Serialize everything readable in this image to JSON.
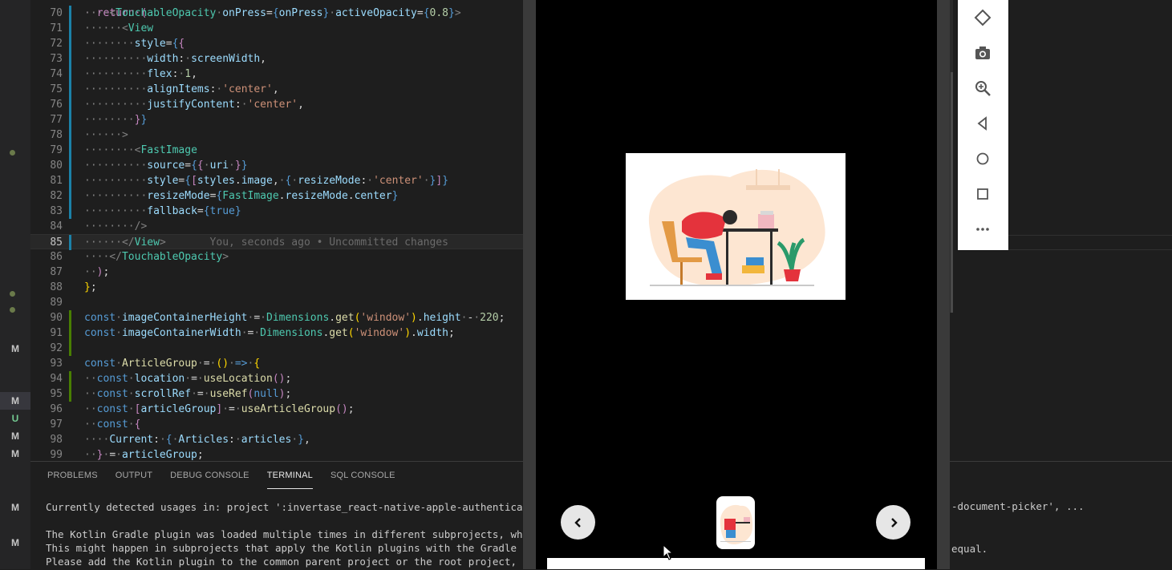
{
  "editor": {
    "lines": [
      {
        "no": "70",
        "bar": "mod",
        "html": "<span class='p'>····</span><span class='p'>&lt;</span><span class='t'>TouchableOpacity</span><span class='p'>·</span><span class='a'>onPress</span><span class='d'>=</span><span class='k'>{</span><span class='a'>onPress</span><span class='k'>}</span><span class='p'>·</span><span class='a'>activeOpacity</span><span class='d'>=</span><span class='k'>{</span><span class='n'>0.8</span><span class='k'>}</span><span class='p'>&gt;</span>"
      },
      {
        "no": "71",
        "bar": "mod",
        "html": "<span class='p'>······&lt;</span><span class='t'>View</span>"
      },
      {
        "no": "72",
        "bar": "mod",
        "html": "<span class='p'>········</span><span class='a'>style</span><span class='d'>=</span><span class='k'>{</span><span class='c'>{</span>"
      },
      {
        "no": "73",
        "bar": "mod",
        "html": "<span class='p'>··········</span><span class='a'>width</span><span class='d'>:</span><span class='p'>·</span><span class='a'>screenWidth</span><span class='d'>,</span>"
      },
      {
        "no": "74",
        "bar": "mod",
        "html": "<span class='p'>··········</span><span class='a'>flex</span><span class='d'>:</span><span class='p'>·</span><span class='n'>1</span><span class='d'>,</span>"
      },
      {
        "no": "75",
        "bar": "mod",
        "html": "<span class='p'>··········</span><span class='a'>alignItems</span><span class='d'>:</span><span class='p'>·</span><span class='s'>'center'</span><span class='d'>,</span>"
      },
      {
        "no": "76",
        "bar": "mod",
        "html": "<span class='p'>··········</span><span class='a'>justifyContent</span><span class='d'>:</span><span class='p'>·</span><span class='s'>'center'</span><span class='d'>,</span>"
      },
      {
        "no": "77",
        "bar": "mod",
        "html": "<span class='p'>········</span><span class='c'>}</span><span class='k'>}</span>"
      },
      {
        "no": "78",
        "bar": "mod",
        "html": "<span class='p'>······&gt;</span>"
      },
      {
        "no": "79",
        "bar": "mod",
        "html": "<span class='p'>········&lt;</span><span class='t'>FastImage</span>"
      },
      {
        "no": "80",
        "bar": "mod",
        "html": "<span class='p'>··········</span><span class='a'>source</span><span class='d'>=</span><span class='k'>{</span><span class='c'>{</span><span class='p'>·</span><span class='a'>uri</span><span class='p'>·</span><span class='c'>}</span><span class='k'>}</span>"
      },
      {
        "no": "81",
        "bar": "mod",
        "html": "<span class='p'>··········</span><span class='a'>style</span><span class='d'>=</span><span class='k'>{</span><span class='c'>[</span><span class='a'>styles</span><span class='d'>.</span><span class='a'>image</span><span class='d'>,</span><span class='p'>·</span><span class='k'>{</span><span class='p'>·</span><span class='a'>resizeMode</span><span class='d'>:</span><span class='p'>·</span><span class='s'>'center'</span><span class='p'>·</span><span class='k'>}</span><span class='c'>]</span><span class='k'>}</span>"
      },
      {
        "no": "82",
        "bar": "mod",
        "html": "<span class='p'>··········</span><span class='a'>resizeMode</span><span class='d'>=</span><span class='k'>{</span><span class='t'>FastImage</span><span class='d'>.</span><span class='a'>resizeMode</span><span class='d'>.</span><span class='a'>center</span><span class='k'>}</span>"
      },
      {
        "no": "83",
        "bar": "mod",
        "html": "<span class='p'>··········</span><span class='a'>fallback</span><span class='d'>=</span><span class='k'>{true}</span>"
      },
      {
        "no": "84",
        "bar": "",
        "html": "<span class='p'>········/&gt;</span>"
      },
      {
        "no": "85",
        "bar": "mod",
        "current": true,
        "html": "<span class='p'>······&lt;/</span><span class='t'>View</span><span class='p'>&gt;</span><span class='blame'>       You, seconds ago • Uncommitted changes</span>"
      },
      {
        "no": "86",
        "bar": "",
        "html": "<span class='p'>····&lt;/</span><span class='t'>TouchableOpacity</span><span class='p'>&gt;</span>"
      },
      {
        "no": "87",
        "bar": "",
        "html": "<span class='p'>··</span><span class='c'>)</span><span class='d'>;</span>"
      },
      {
        "no": "88",
        "bar": "",
        "html": "<span class='b'>}</span><span class='d'>;</span>"
      },
      {
        "no": "89",
        "bar": "",
        "html": ""
      },
      {
        "no": "90",
        "bar": "add",
        "html": "<span class='k'>const</span><span class='p'>·</span><span class='a'>imageContainerHeight</span><span class='p'>·</span><span class='d'>=</span><span class='p'>·</span><span class='t'>Dimensions</span><span class='d'>.</span><span class='f'>get</span><span class='b'>(</span><span class='s'>'window'</span><span class='b'>)</span><span class='d'>.</span><span class='a'>height</span><span class='p'>·</span><span class='d'>-</span><span class='p'>·</span><span class='n'>220</span><span class='d'>;</span>"
      },
      {
        "no": "91",
        "bar": "add",
        "html": "<span class='k'>const</span><span class='p'>·</span><span class='a'>imageContainerWidth</span><span class='p'>·</span><span class='d'>=</span><span class='p'>·</span><span class='t'>Dimensions</span><span class='d'>.</span><span class='f'>get</span><span class='b'>(</span><span class='s'>'window'</span><span class='b'>)</span><span class='d'>.</span><span class='a'>width</span><span class='d'>;</span>"
      },
      {
        "no": "92",
        "bar": "add",
        "html": ""
      },
      {
        "no": "93",
        "bar": "",
        "html": "<span class='k'>const</span><span class='p'>·</span><span class='f'>ArticleGroup</span><span class='p'>·</span><span class='d'>=</span><span class='p'>·</span><span class='b'>()</span><span class='p'>·</span><span class='k'>=&gt;</span><span class='p'>·</span><span class='b'>{</span>"
      },
      {
        "no": "94",
        "bar": "add",
        "html": "<span class='p'>··</span><span class='k'>const</span><span class='p'>·</span><span class='a'>location</span><span class='p'>·</span><span class='d'>=</span><span class='p'>·</span><span class='f'>useLocation</span><span class='c'>()</span><span class='d'>;</span>"
      },
      {
        "no": "95",
        "bar": "add",
        "html": "<span class='p'>··</span><span class='k'>const</span><span class='p'>·</span><span class='a'>scrollRef</span><span class='p'>·</span><span class='d'>=</span><span class='p'>·</span><span class='f'>useRef</span><span class='c'>(</span><span class='k'>null</span><span class='c'>)</span><span class='d'>;</span>"
      },
      {
        "no": "96",
        "bar": "",
        "html": "<span class='p'>··</span><span class='k'>const</span><span class='p'>·</span><span class='c'>[</span><span class='a'>articleGroup</span><span class='c'>]</span><span class='p'>·</span><span class='d'>=</span><span class='p'>·</span><span class='f'>useArticleGroup</span><span class='c'>()</span><span class='d'>;</span>"
      },
      {
        "no": "97",
        "bar": "",
        "html": "<span class='p'>··</span><span class='k'>const</span><span class='p'>·</span><span class='c'>{</span>"
      },
      {
        "no": "98",
        "bar": "",
        "html": "<span class='p'>····</span><span class='a'>Current</span><span class='d'>:</span><span class='p'>·</span><span class='k'>{</span><span class='p'>·</span><span class='a'>Articles</span><span class='d'>:</span><span class='p'>·</span><span class='a'>articles</span><span class='p'>·</span><span class='k'>}</span><span class='d'>,</span>"
      },
      {
        "no": "99",
        "bar": "",
        "html": "<span class='p'>··</span><span class='c'>}</span><span class='p'>·</span><span class='d'>=</span><span class='p'>·</span><span class='a'>articleGroup</span><span class='d'>;</span>"
      }
    ]
  },
  "gutter": {
    "marks": [
      {
        "label": "M",
        "cls": ""
      },
      {
        "label": "M",
        "cls": "sel"
      },
      {
        "label": "U",
        "cls": "u"
      },
      {
        "label": "M",
        "cls": ""
      },
      {
        "label": "M",
        "cls": ""
      },
      {
        "label": "M",
        "cls": ""
      },
      {
        "label": "M",
        "cls": ""
      }
    ]
  },
  "panel": {
    "tabs": [
      "PROBLEMS",
      "OUTPUT",
      "DEBUG CONSOLE",
      "TERMINAL",
      "SQL CONSOLE"
    ],
    "active_tab": "TERMINAL",
    "terminal_lines": [
      "Currently detected usages in: project ':invertase_react-native-apple-authentication',",
      "",
      "The Kotlin Gradle plugin was loaded multiple times in different subprojects, which is",
      "This might happen in subprojects that apply the Kotlin plugins with the Gradle 'plugi",
      "Please add the Kotlin plugin to the common parent project or the root project, then r"
    ],
    "terminal_right": [
      "-document-picker', ...",
      "equal."
    ]
  },
  "emulator": {
    "prev_icon": "chevron-left-icon",
    "next_icon": "chevron-right-icon",
    "hero_image": "tired-person-at-desk-illustration",
    "toolbar_icons": [
      "rotate-icon",
      "camera-icon",
      "zoom-icon",
      "back-icon",
      "home-icon",
      "overview-icon",
      "more-icon"
    ]
  },
  "colors": {
    "editor_bg": "#1e1e1e",
    "modified_bar": "#1b81a8",
    "added_bar": "#487e02",
    "emulator_screen": "#000000"
  }
}
